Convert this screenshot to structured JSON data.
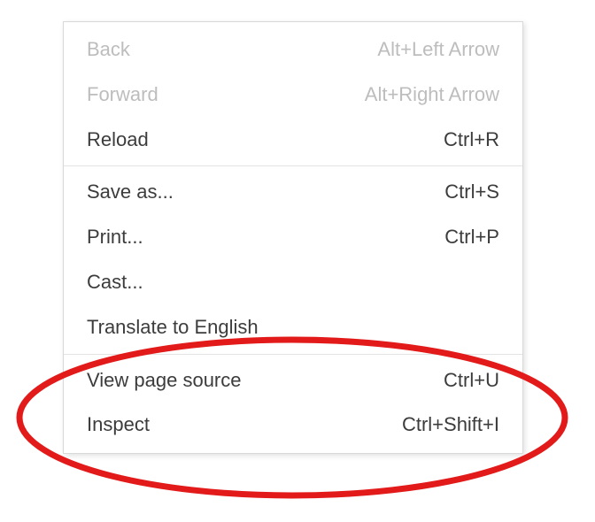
{
  "menu": {
    "items": [
      {
        "label": "Back",
        "shortcut": "Alt+Left Arrow",
        "disabled": true
      },
      {
        "label": "Forward",
        "shortcut": "Alt+Right Arrow",
        "disabled": true
      },
      {
        "label": "Reload",
        "shortcut": "Ctrl+R",
        "disabled": false
      }
    ],
    "items2": [
      {
        "label": "Save as...",
        "shortcut": "Ctrl+S"
      },
      {
        "label": "Print...",
        "shortcut": "Ctrl+P"
      },
      {
        "label": "Cast..."
      },
      {
        "label": "Translate to English"
      }
    ],
    "items3": [
      {
        "label": "View page source",
        "shortcut": "Ctrl+U"
      },
      {
        "label": "Inspect",
        "shortcut": "Ctrl+Shift+I"
      }
    ]
  },
  "annotation": {
    "stroke": "#e21a1a",
    "stroke_width": 7
  }
}
